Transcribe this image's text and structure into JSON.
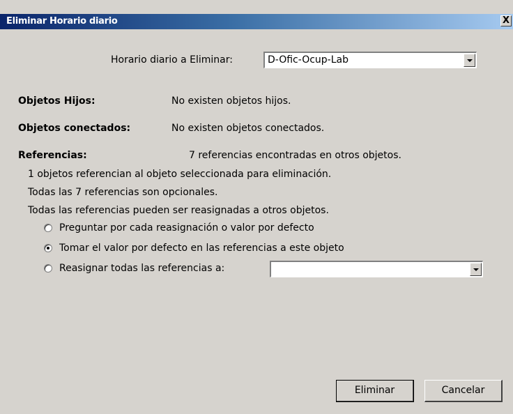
{
  "window": {
    "title": "Eliminar Horario diario",
    "close_label": "X"
  },
  "selector": {
    "label": "Horario diario a Eliminar:",
    "value": "D-Ofic-Ocup-Lab"
  },
  "info": {
    "children_label": "Objetos Hijos:",
    "children_value": "No existen objetos hijos.",
    "connected_label": "Objetos conectados:",
    "connected_value": "No existen objetos conectados.",
    "references_label": "Referencias:",
    "references_value": "7 referencias encontradas en otros objetos.",
    "line1": "1 objetos referencian al objeto seleccionada para eliminación.",
    "line2": "Todas las 7 referencias son opcionales.",
    "line3": "Todas las referencias pueden ser reasignadas a otros objetos."
  },
  "options": [
    {
      "label": "Preguntar por cada reasignación o valor por defecto",
      "checked": false
    },
    {
      "label": "Tomar el valor por defecto en las referencias a este objeto",
      "checked": true
    },
    {
      "label": "Reasignar todas las referencias a:",
      "checked": false
    }
  ],
  "reassign_target": {
    "value": ""
  },
  "buttons": {
    "delete": "Eliminar",
    "cancel": "Cancelar"
  }
}
